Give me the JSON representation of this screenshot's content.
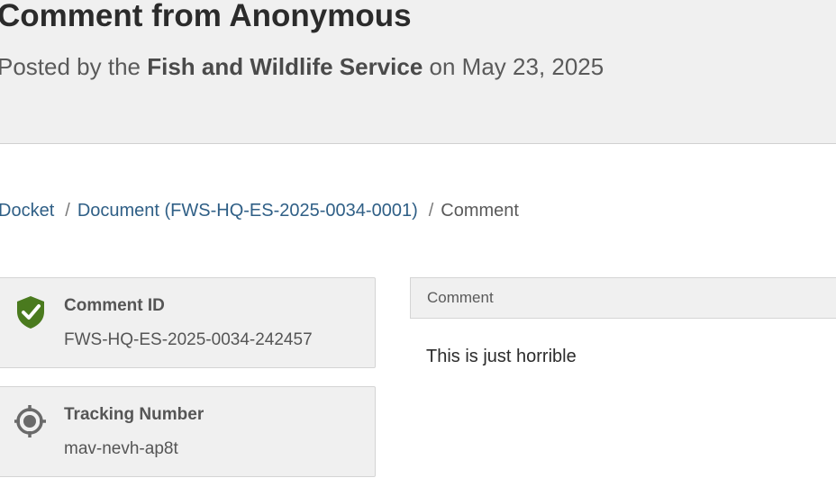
{
  "header": {
    "title": "Comment from Anonymous",
    "posted_prefix": "Posted by the ",
    "agency": "Fish and Wildlife Service",
    "posted_suffix": " on May 23, 2025"
  },
  "breadcrumb": {
    "items": [
      {
        "label": "Docket"
      },
      {
        "label": "Document (FWS-HQ-ES-2025-0034-0001)"
      },
      {
        "label": "Comment"
      }
    ],
    "separator": "/"
  },
  "details": {
    "comment_id": {
      "icon": "shield-check-icon",
      "label": "Comment ID",
      "value": "FWS-HQ-ES-2025-0034-242457",
      "icon_color": "#4a7a1e"
    },
    "tracking_number": {
      "icon": "crosshair-target-icon",
      "label": "Tracking Number",
      "value": "mav-nevh-ap8t",
      "icon_color": "#6a6a6a"
    }
  },
  "comment": {
    "header_label": "Comment",
    "text": "This is just horrible"
  },
  "colors": {
    "link": "#2f5f86",
    "header_bg": "#f0f0f0",
    "card_bg": "#f0f0f0"
  }
}
